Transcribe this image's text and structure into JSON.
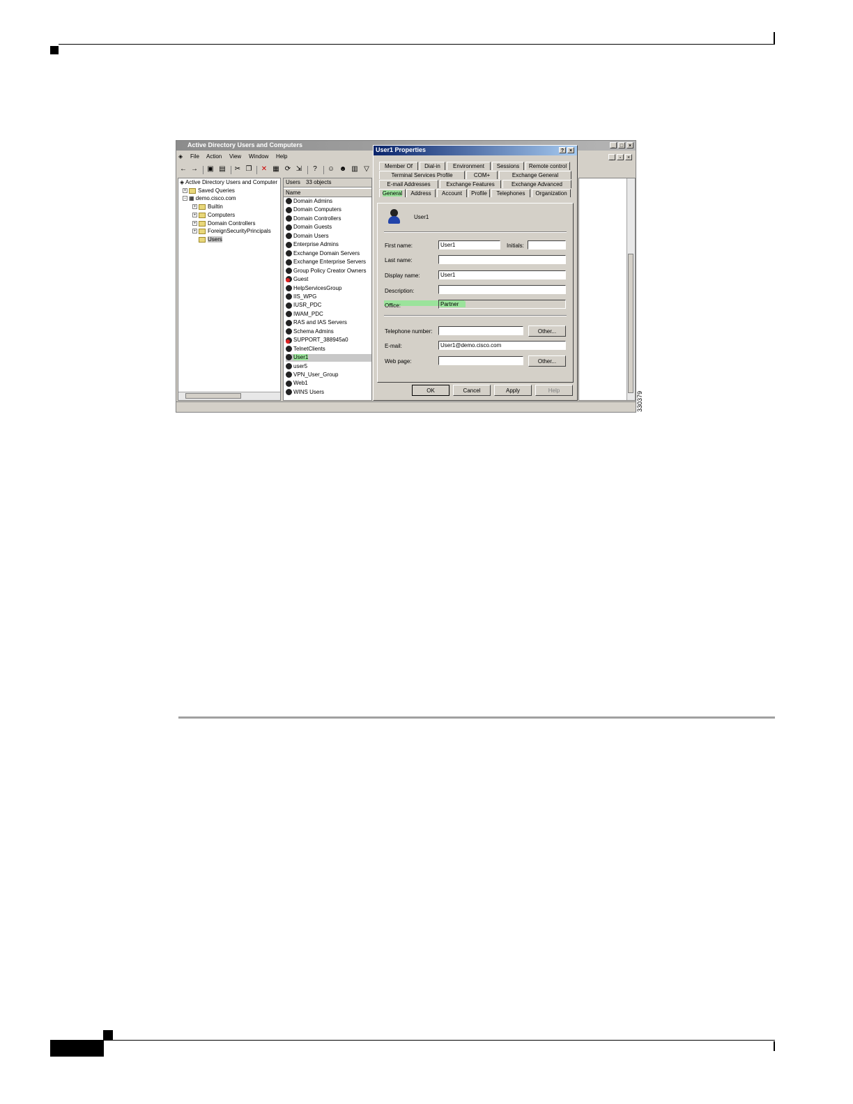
{
  "figure_id": "330379",
  "window": {
    "title": "Active Directory Users and Computers",
    "menu": [
      "File",
      "Action",
      "View",
      "Window",
      "Help"
    ]
  },
  "tree": {
    "root": "Active Directory Users and Computer",
    "saved_queries": "Saved Queries",
    "domain": "demo.cisco.com",
    "children": [
      "Builtin",
      "Computers",
      "Domain Controllers",
      "ForeignSecurityPrincipals",
      "Users"
    ]
  },
  "list": {
    "container": "Users",
    "count": "33 objects",
    "column": "Name",
    "items": [
      "Domain Admins",
      "Domain Computers",
      "Domain Controllers",
      "Domain Guests",
      "Domain Users",
      "Enterprise Admins",
      "Exchange Domain Servers",
      "Exchange Enterprise Servers",
      "Group Policy Creator Owners",
      "Guest",
      "HelpServicesGroup",
      "IIS_WPG",
      "IUSR_PDC",
      "IWAM_PDC",
      "RAS and IAS Servers",
      "Schema Admins",
      "SUPPORT_388945a0",
      "TelnetClients",
      "User1",
      "user5",
      "VPN_User_Group",
      "Web1",
      "WINS Users"
    ]
  },
  "dialog": {
    "title": "User1 Properties",
    "help_btn": "?",
    "close_btn": "×",
    "tabs_row1": [
      "Member Of",
      "Dial-in",
      "Environment",
      "Sessions",
      "Remote control"
    ],
    "tabs_row2": [
      "Terminal Services Profile",
      "COM+",
      "Exchange General"
    ],
    "tabs_row3": [
      "E-mail Addresses",
      "Exchange Features",
      "Exchange Advanced"
    ],
    "tabs_row4": [
      "General",
      "Address",
      "Account",
      "Profile",
      "Telephones",
      "Organization"
    ],
    "user_name": "User1",
    "fields": {
      "first_name_label": "First name:",
      "first_name": "User1",
      "initials_label": "Initials:",
      "initials": "",
      "last_name_label": "Last name:",
      "last_name": "",
      "display_name_label": "Display name:",
      "display_name": "User1",
      "description_label": "Description:",
      "description": "",
      "office_label": "Office:",
      "office": "Partner",
      "telephone_label": "Telephone number:",
      "telephone": "",
      "email_label": "E-mail:",
      "email": "User1@demo.cisco.com",
      "webpage_label": "Web page:",
      "webpage": ""
    },
    "other_btn": "Other...",
    "ok": "OK",
    "cancel": "Cancel",
    "apply": "Apply",
    "help": "Help"
  }
}
